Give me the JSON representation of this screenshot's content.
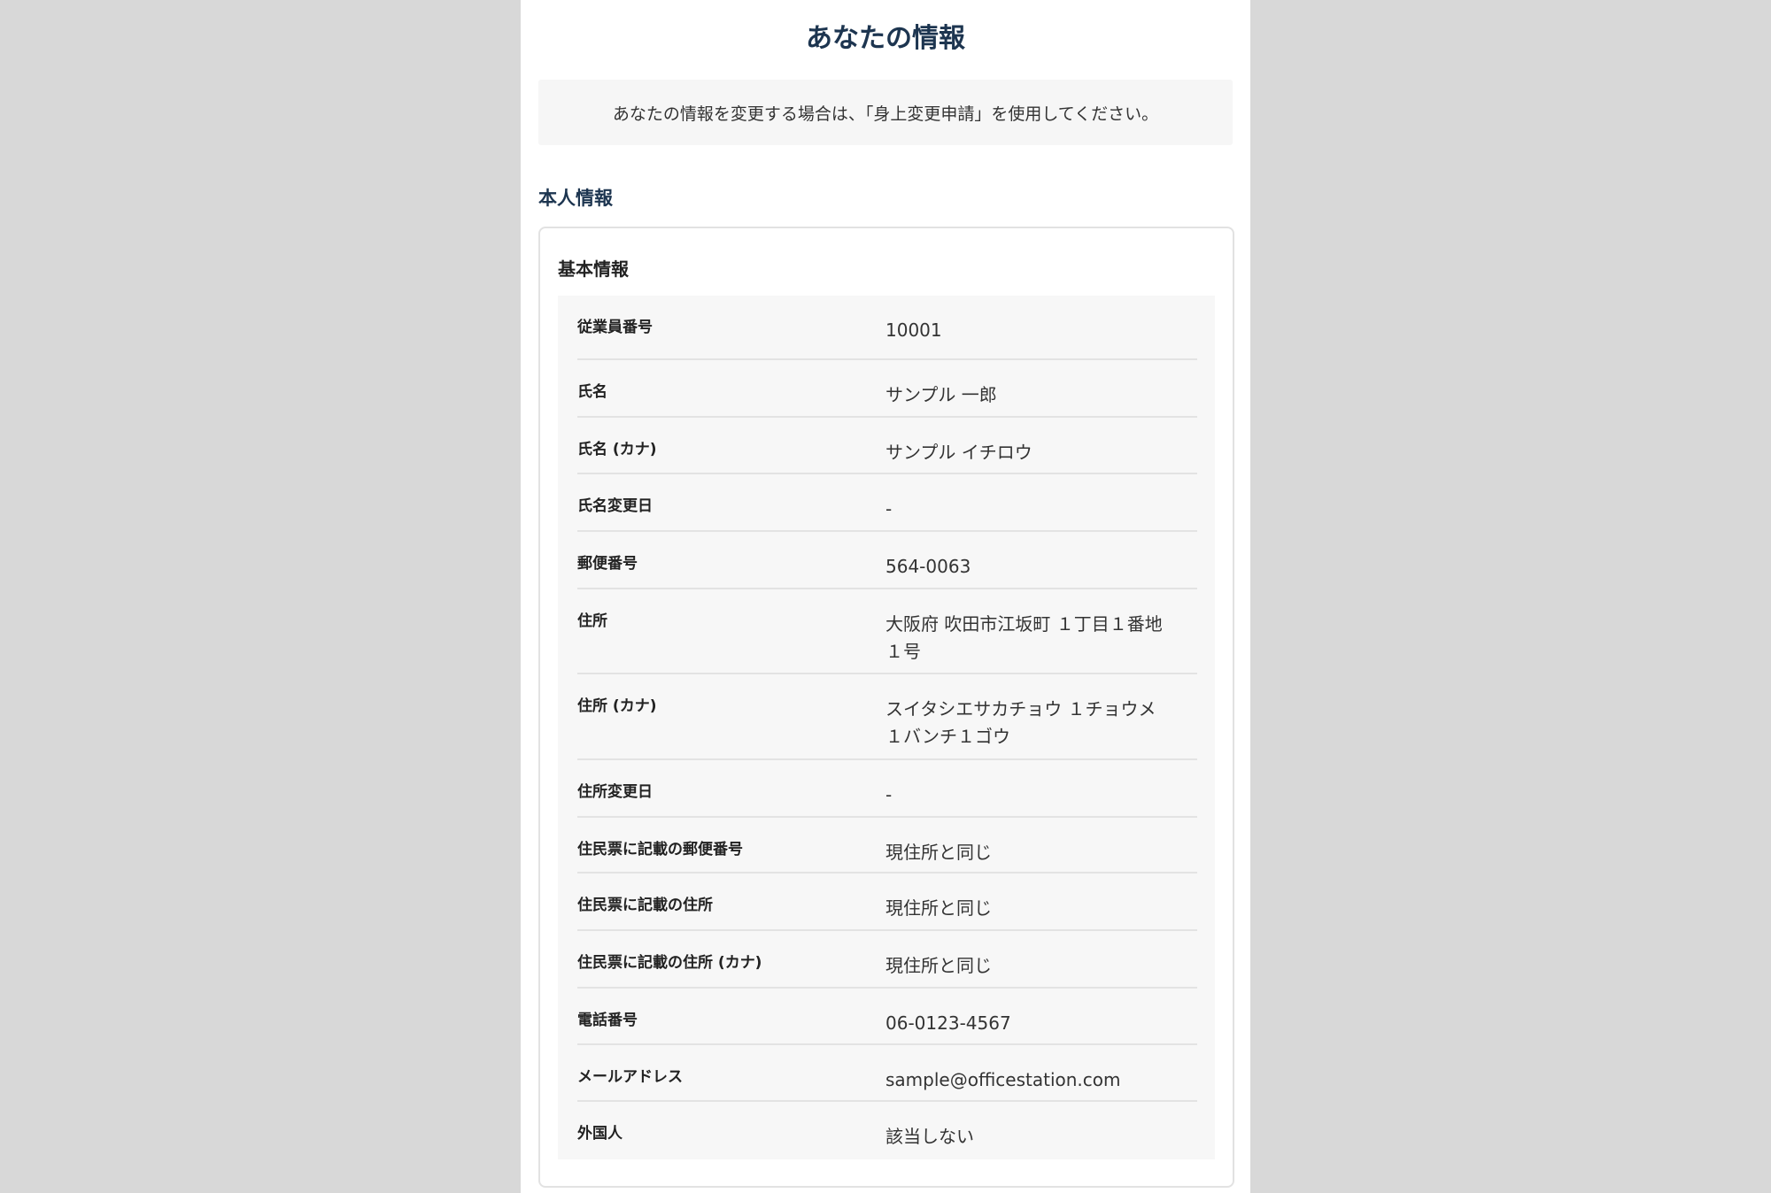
{
  "page": {
    "title": "あなたの情報",
    "notice": "あなたの情報を変更する場合は、「身上変更申請」を使用してください。"
  },
  "section": {
    "title": "本人情報",
    "card": {
      "title": "基本情報",
      "rows": [
        {
          "label": "従業員番号",
          "value": "10001"
        },
        {
          "label": "氏名",
          "value": "サンプル 一郎"
        },
        {
          "label": "氏名 (カナ)",
          "value": "サンプル イチロウ"
        },
        {
          "label": "氏名変更日",
          "value": "-"
        },
        {
          "label": "郵便番号",
          "value": "564-0063"
        },
        {
          "label": "住所",
          "value": "大阪府 吹田市江坂町 １丁目１番地\n１号"
        },
        {
          "label": "住所 (カナ)",
          "value": "スイタシエサカチョウ １チョウメ\n１バンチ１ゴウ"
        },
        {
          "label": "住所変更日",
          "value": "-"
        },
        {
          "label": "住民票に記載の郵便番号",
          "value": "現住所と同じ"
        },
        {
          "label": "住民票に記載の住所",
          "value": "現住所と同じ"
        },
        {
          "label": "住民票に記載の住所 (カナ)",
          "value": "現住所と同じ"
        },
        {
          "label": "電話番号",
          "value": "06-0123-4567"
        },
        {
          "label": "メールアドレス",
          "value": "sample@officestation.com"
        },
        {
          "label": "外国人",
          "value": "該当しない"
        }
      ]
    }
  }
}
